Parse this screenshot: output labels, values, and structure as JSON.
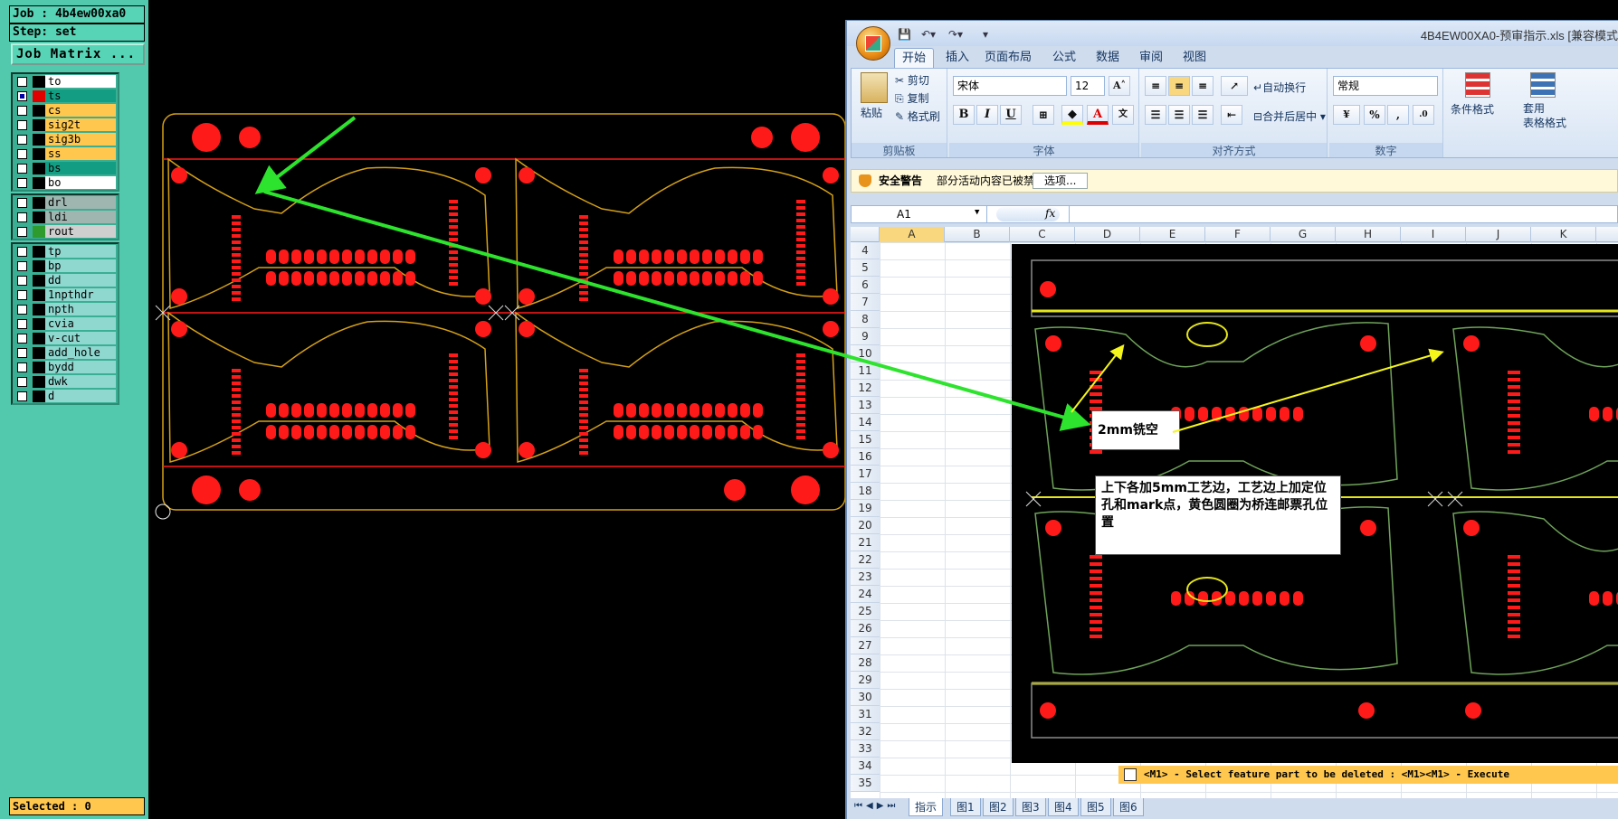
{
  "cam": {
    "job_label": "Job : 4b4ew00xa0",
    "step_label": "Step: set",
    "job_matrix_button": "Job Matrix ...",
    "selected_status": "Selected : 0",
    "command_hint": "<M1> - Select feature part to be deleted : <M1><M1> - Execute",
    "layer_groups": [
      [
        {
          "name": "to",
          "color": "#ffffff",
          "swatch": "#000000",
          "checked": false
        },
        {
          "name": "ts",
          "color": "#139e84",
          "swatch": "#e00000",
          "checked": true
        },
        {
          "name": "cs",
          "color": "#ffc74e",
          "swatch": "#000000",
          "checked": false
        },
        {
          "name": "sig2t",
          "color": "#ffc74e",
          "swatch": "#000000",
          "checked": false
        },
        {
          "name": "sig3b",
          "color": "#ffc74e",
          "swatch": "#000000",
          "checked": false
        },
        {
          "name": "ss",
          "color": "#ffc74e",
          "swatch": "#000000",
          "checked": false
        },
        {
          "name": "bs",
          "color": "#139e84",
          "swatch": "#000000",
          "checked": false
        },
        {
          "name": "bo",
          "color": "#ffffff",
          "swatch": "#000000",
          "checked": false
        }
      ],
      [
        {
          "name": "drl",
          "color": "#9fb6b0",
          "swatch": "#000000",
          "checked": false
        },
        {
          "name": "ldi",
          "color": "#9fb6b0",
          "swatch": "#000000",
          "checked": false
        },
        {
          "name": "rout",
          "color": "#cfcfcf",
          "swatch": "#2e9b2e",
          "checked": false
        }
      ],
      [
        {
          "name": "tp",
          "color": "#8fd8d0",
          "swatch": "#000000",
          "checked": false
        },
        {
          "name": "bp",
          "color": "#8fd8d0",
          "swatch": "#000000",
          "checked": false
        },
        {
          "name": "dd",
          "color": "#8fd8d0",
          "swatch": "#000000",
          "checked": false
        },
        {
          "name": "1npthdr",
          "color": "#8fd8d0",
          "swatch": "#000000",
          "checked": false
        },
        {
          "name": "npth",
          "color": "#8fd8d0",
          "swatch": "#000000",
          "checked": false
        },
        {
          "name": "cvia",
          "color": "#8fd8d0",
          "swatch": "#000000",
          "checked": false
        },
        {
          "name": "v-cut",
          "color": "#8fd8d0",
          "swatch": "#000000",
          "checked": false
        },
        {
          "name": "add_hole",
          "color": "#8fd8d0",
          "swatch": "#000000",
          "checked": false
        },
        {
          "name": "bydd",
          "color": "#8fd8d0",
          "swatch": "#000000",
          "checked": false
        },
        {
          "name": "dwk",
          "color": "#8fd8d0",
          "swatch": "#000000",
          "checked": false
        },
        {
          "name": "d",
          "color": "#8fd8d0",
          "swatch": "#000000",
          "checked": false
        }
      ]
    ]
  },
  "excel": {
    "doc_title": "4B4EW00XA0-预审指示.xls  [兼容模式",
    "tabs": [
      "开始",
      "插入",
      "页面布局",
      "公式",
      "数据",
      "审阅",
      "视图"
    ],
    "clipboard": {
      "paste": "粘贴",
      "cut": "剪切",
      "copy": "复制",
      "format_painter": "格式刷",
      "group": "剪贴板"
    },
    "font": {
      "name": "宋体",
      "size": "12",
      "group": "字体"
    },
    "alignment": {
      "wrap": "自动换行",
      "merge": "合并后居中",
      "group": "对齐方式"
    },
    "number": {
      "format": "常规",
      "group": "数字"
    },
    "styles": {
      "conditional": "条件格式",
      "table": "套用\n表格格式"
    },
    "security": {
      "label": "安全警告",
      "message": "部分活动内容已被禁用。",
      "options_button": "选项..."
    },
    "name_box": "A1",
    "fx": "fx",
    "columns": [
      "A",
      "B",
      "C",
      "D",
      "E",
      "F",
      "G",
      "H",
      "I",
      "J",
      "K"
    ],
    "rows": [
      "4",
      "5",
      "6",
      "7",
      "8",
      "9",
      "10",
      "11",
      "12",
      "13",
      "14",
      "15",
      "16",
      "17",
      "18",
      "19",
      "20",
      "21",
      "22",
      "23",
      "24",
      "25",
      "26",
      "27",
      "28",
      "29",
      "30",
      "31",
      "32",
      "33",
      "34",
      "35"
    ],
    "sheet_tabs": [
      "指示",
      "图1",
      "图2",
      "图3",
      "图4",
      "图5",
      "图6"
    ],
    "notes": {
      "milling": "2mm铣空",
      "process": "上下各加5mm工艺边，工艺边上加定位孔和mark点，黄色圆圈为桥连邮票孔位置"
    }
  }
}
